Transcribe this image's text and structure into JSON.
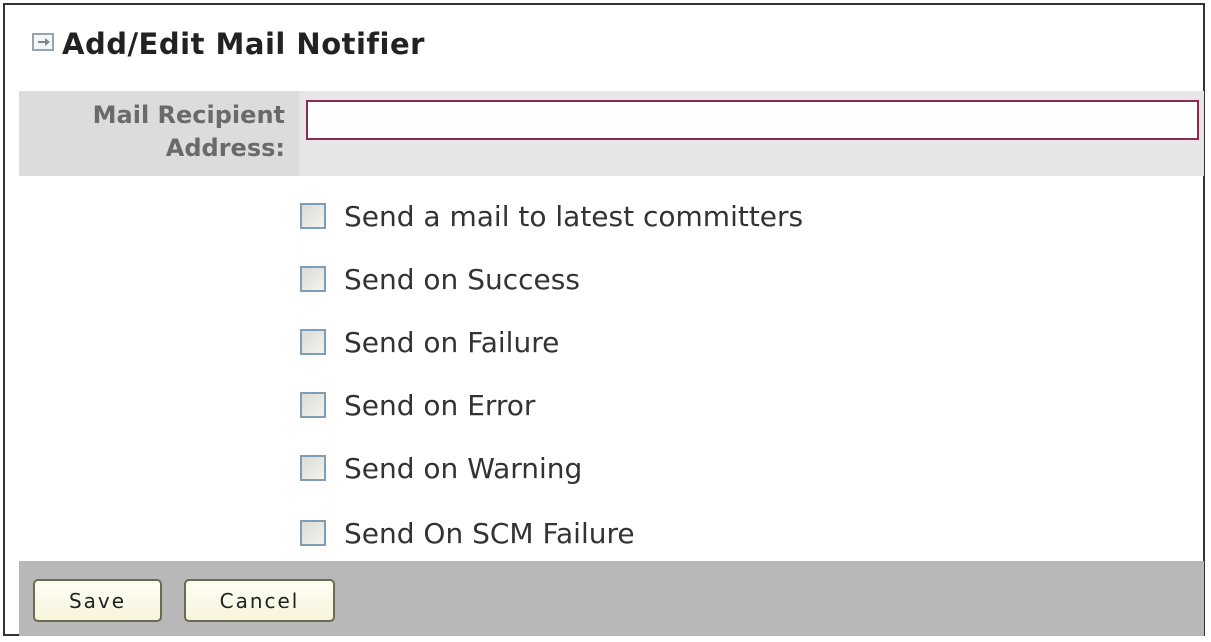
{
  "header": {
    "icon": "expand-panel-icon",
    "title": "Add/Edit Mail Notifier"
  },
  "recipient": {
    "label_line1": "Mail Recipient",
    "label_line2": "Address:",
    "value": ""
  },
  "options": [
    {
      "label": "Send a mail to latest committers",
      "checked": false
    },
    {
      "label": "Send on Success",
      "checked": false
    },
    {
      "label": "Send on Failure",
      "checked": false
    },
    {
      "label": "Send on Error",
      "checked": false
    },
    {
      "label": "Send on Warning",
      "checked": false
    },
    {
      "label": "Send On SCM Failure",
      "checked": false
    }
  ],
  "buttons": {
    "save": "Save",
    "cancel": "Cancel"
  },
  "colors": {
    "input_border": "#8a2a55",
    "checkbox_border": "#7f9db9",
    "footer_bg": "#b8b8b8",
    "label_bg": "#dcdcdc"
  }
}
